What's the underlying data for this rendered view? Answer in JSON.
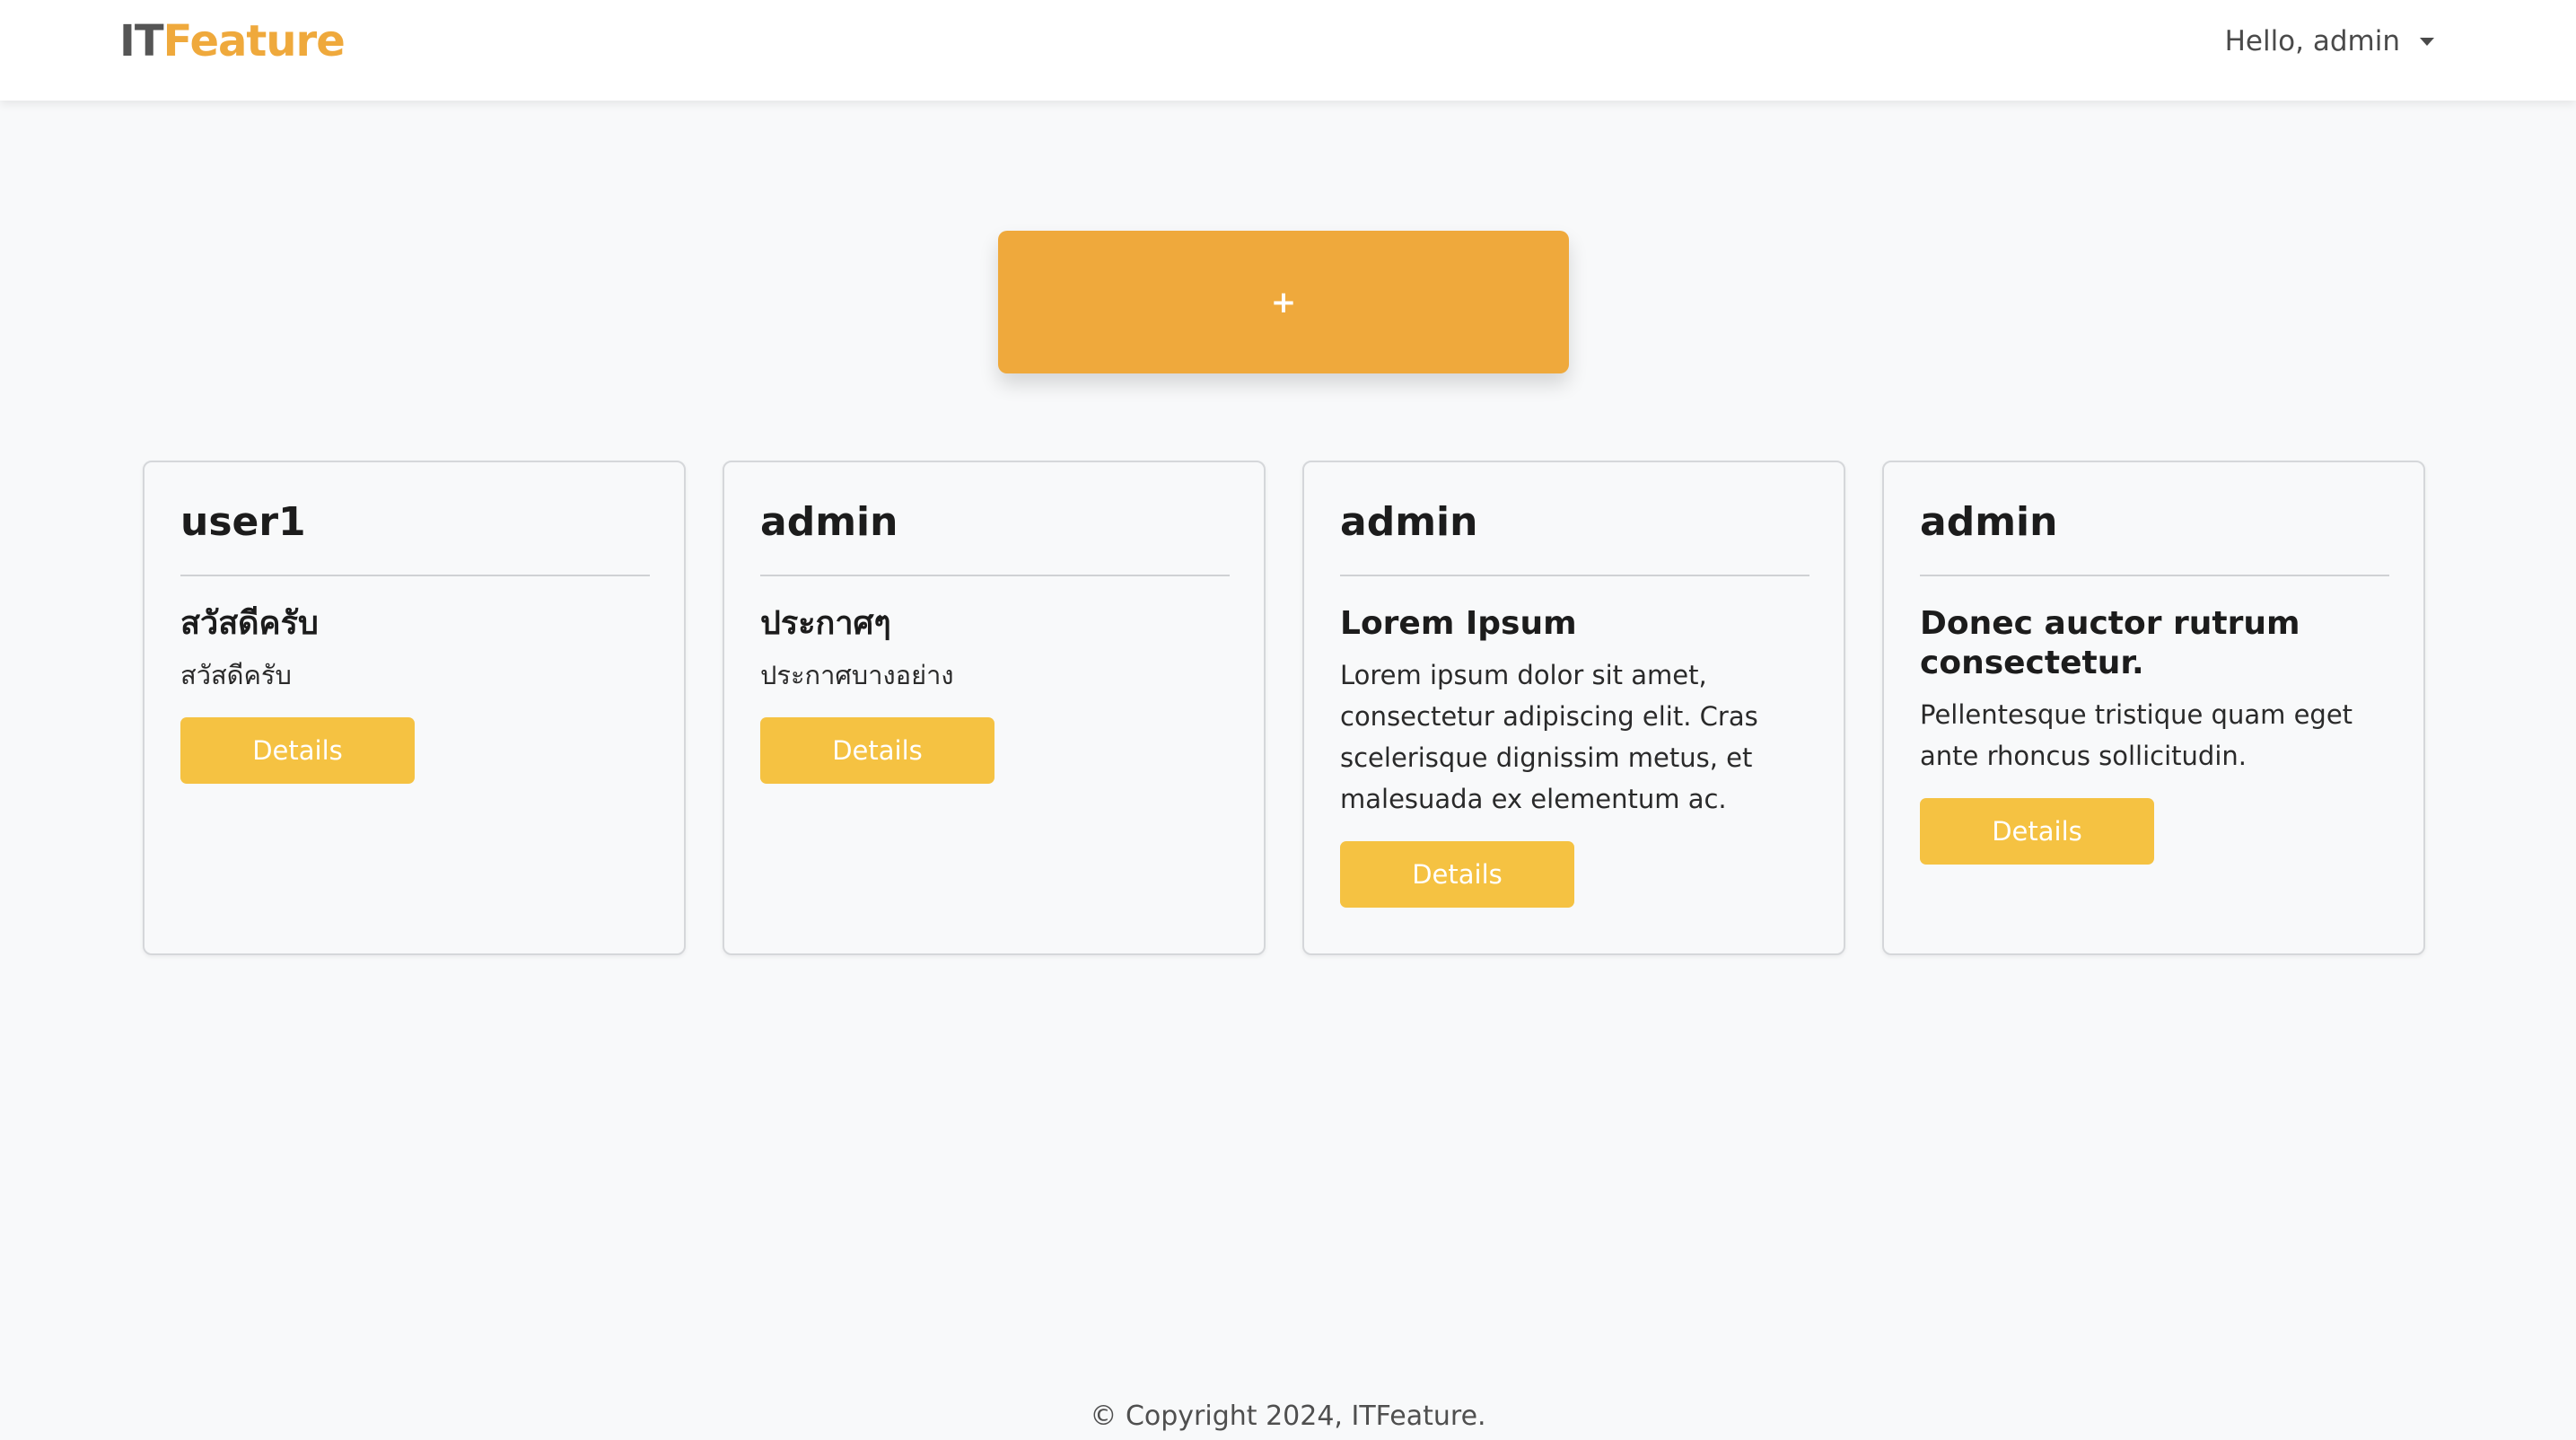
{
  "navbar": {
    "brand_part1": "IT",
    "brand_part2": "Feature",
    "user_greeting": "Hello, admin"
  },
  "add_button": {
    "label": "+"
  },
  "cards": [
    {
      "author": "user1",
      "title": "สวัสดีครับ",
      "text": "สวัสดีครับ",
      "button_label": "Details"
    },
    {
      "author": "admin",
      "title": "ประกาศๆ",
      "text": "ประกาศบางอย่าง",
      "button_label": "Details"
    },
    {
      "author": "admin",
      "title": "Lorem Ipsum",
      "text": "Lorem ipsum dolor sit amet, consectetur adipiscing elit. Cras scelerisque dignissim metus, et malesuada ex elementum ac.",
      "button_label": "Details"
    },
    {
      "author": "admin",
      "title": "Donec auctor rutrum consectetur.",
      "text": "Pellentesque tristique quam eget ante rhoncus sollicitudin.",
      "button_label": "Details"
    }
  ],
  "footer": {
    "text": "© Copyright 2024, ITFeature."
  },
  "colors": {
    "accent": "#efa93c",
    "button_yellow": "#f5c242",
    "background": "#f8f9fa"
  },
  "icons": {
    "user_menu": "chevron-down-icon"
  }
}
